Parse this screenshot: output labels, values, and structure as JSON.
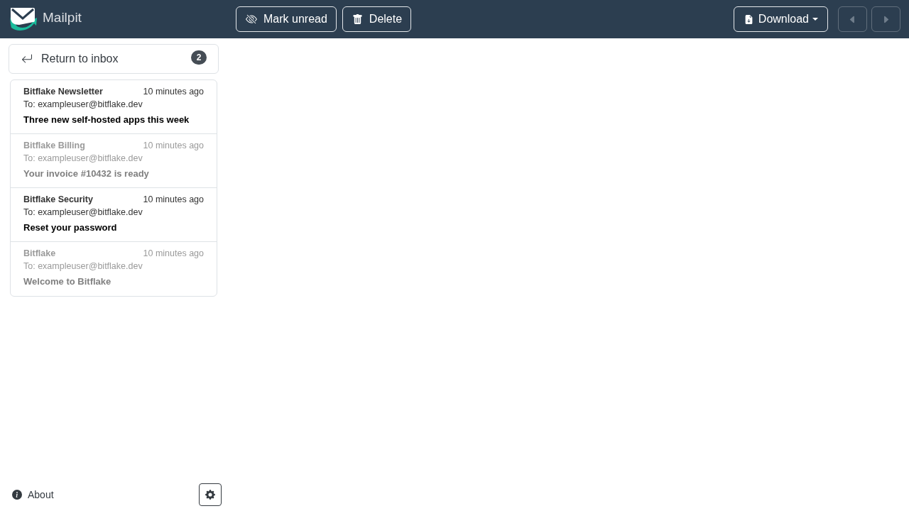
{
  "header": {
    "brand": "Mailpit",
    "actions": [
      {
        "kind": "mark",
        "label": "Mark unread"
      },
      {
        "kind": "delete",
        "label": "Delete"
      }
    ],
    "download": {
      "label": "Download"
    },
    "navigation": [
      {
        "kind": "previous",
        "disabled": true
      },
      {
        "kind": "next",
        "disabled": true
      }
    ]
  },
  "sidebar": {
    "return_button": {
      "label": "Return to inbox",
      "badge": "2"
    },
    "messages": [
      {
        "from": "Bitflake Newsletter",
        "time": "10 minutes ago",
        "to": "To: exampleuser@bitflake.dev",
        "subject": "Three new self-hosted apps this week",
        "read": false
      },
      {
        "from": "Bitflake Billing",
        "time": "10 minutes ago",
        "to": "To: exampleuser@bitflake.dev",
        "subject": "Your invoice #10432 is ready",
        "read": true
      },
      {
        "from": "Bitflake Security",
        "time": "10 minutes ago",
        "to": "To: exampleuser@bitflake.dev",
        "subject": "Reset your password",
        "read": false
      },
      {
        "from": "Bitflake",
        "time": "10 minutes ago",
        "to": "To: exampleuser@bitflake.dev",
        "subject": "Welcome to Bitflake",
        "read": true
      }
    ],
    "about": {
      "label": "About"
    }
  }
}
